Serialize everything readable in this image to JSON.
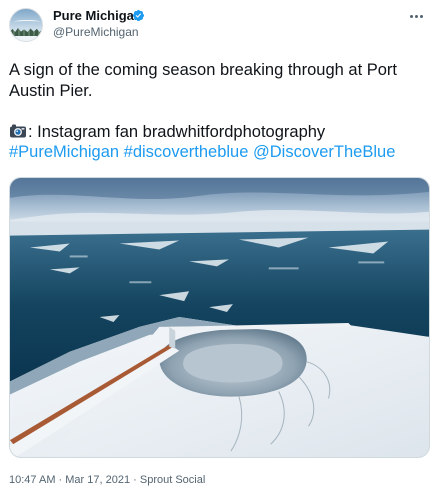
{
  "author": {
    "display_name": "Pure Michigan",
    "handle": "@PureMichigan",
    "verified_icon": "verified-badge-icon",
    "avatar_icon": "pure-michigan-avatar"
  },
  "tweet": {
    "line1": "A sign of the coming season breaking through at Port",
    "line2": "Austin Pier.",
    "camera_icon": "camera-emoji-icon",
    "credit": ": Instagram fan bradwhitfordphotography",
    "tag1": "#PureMichigan",
    "tag2": "#discovertheblue",
    "mention": "@DiscoverTheBlue"
  },
  "meta": {
    "time": "10:47 AM",
    "date": "Mar 17, 2021",
    "source": "Sprout Social",
    "separator": " · "
  },
  "colors": {
    "link": "#1d9bf0",
    "secondary_text": "#536471",
    "verified": "#1d9bf0"
  }
}
